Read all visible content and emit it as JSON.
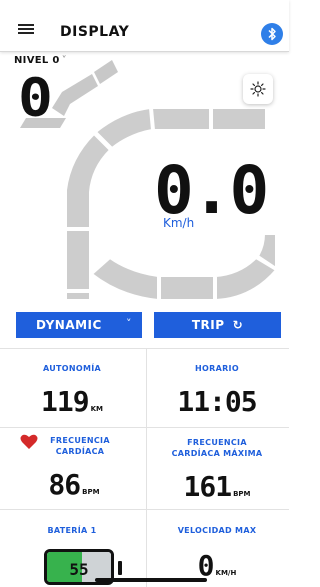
{
  "header": {
    "title": "DISPLAY",
    "menu_icon": "hamburger-menu-icon",
    "bluetooth_icon": "bluetooth-icon",
    "accent": "#2f7fe8"
  },
  "assist": {
    "level_label": "NIVEL 0",
    "value": "0"
  },
  "light": {
    "icon": "sun-icon"
  },
  "speed": {
    "value": "0.0",
    "unit": "Km/h"
  },
  "mode": {
    "label": "DYNAMIC",
    "chevron_icon": "chevron-down-icon"
  },
  "trip": {
    "label": "TRIP",
    "icon": "refresh-icon"
  },
  "stats": {
    "autonomia": {
      "label": "AUTONOMÍA",
      "value": "119",
      "unit": "KM"
    },
    "horario": {
      "label": "HORARIO",
      "value": "11:05"
    },
    "heart_rate": {
      "label_line1": "FRECUENCIA",
      "label_line2": "CARDÍACA",
      "value": "86",
      "unit": "BPM",
      "icon": "heart-icon",
      "icon_color": "#d42a2a"
    },
    "max_heart_rate": {
      "label_line1": "FRECUENCIA",
      "label_line2": "CARDÍACA MÁXIMA",
      "value": "161",
      "unit": "BPM"
    },
    "battery": {
      "label": "BATERÍA 1",
      "value": "55",
      "level": 0.55,
      "fill_color": "#37b24d"
    },
    "max_speed": {
      "label": "VELOCIDAD MAX",
      "value": "0",
      "unit": "KM/H"
    }
  },
  "colors": {
    "primary": "#1f5fdc",
    "gauge": "#c8c8c8"
  }
}
